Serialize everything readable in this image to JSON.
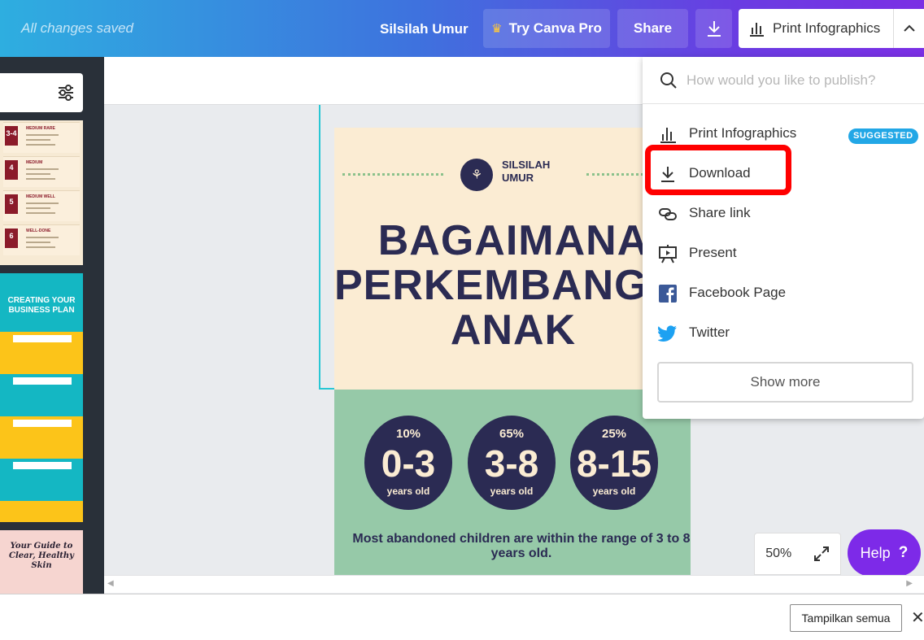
{
  "topbar": {
    "save_status": "All changes saved",
    "doc_title": "Silsilah Umur",
    "try_pro_label": "Try Canva Pro",
    "share_label": "Share",
    "print_label": "Print Infographics"
  },
  "sidebar": {
    "thumb1_rows": [
      {
        "num": "3-4",
        "head": "MEDIUM RARE"
      },
      {
        "num": "4",
        "head": "MEDIUM"
      },
      {
        "num": "5",
        "head": "MEDIUM WELL"
      },
      {
        "num": "6",
        "head": "WELL-DONE"
      }
    ],
    "thumb2_title": "CREATING YOUR BUSINESS PLAN",
    "thumb3_title": "Your Guide to Clear, Healthy Skin"
  },
  "design": {
    "logo_text": "SILSILAH\nUMUR",
    "headline": "BAGAIMANA\nPERKEMBANGAN\nANAK",
    "stats": [
      {
        "pct": "10%",
        "range": "0-3",
        "unit": "years old"
      },
      {
        "pct": "65%",
        "range": "3-8",
        "unit": "years old"
      },
      {
        "pct": "25%",
        "range": "8-15",
        "unit": "years old"
      }
    ],
    "caption": "Most abandoned children are within the range of 3 to 8 years old."
  },
  "zoom": {
    "level": "50%"
  },
  "help": {
    "label": "Help",
    "mark": "?"
  },
  "publish_menu": {
    "search_placeholder": "How would you like to publish?",
    "items": [
      {
        "label": "Print Infographics",
        "badge": "SUGGESTED"
      },
      {
        "label": "Download"
      },
      {
        "label": "Share link"
      },
      {
        "label": "Present"
      },
      {
        "label": "Facebook Page"
      },
      {
        "label": "Twitter"
      }
    ],
    "show_more_label": "Show more"
  },
  "downloads_bar": {
    "show_all_label": "Tampilkan semua"
  },
  "colors": {
    "accent_purple": "#7d2ae8",
    "suggested_badge": "#22a7e6",
    "highlight_red": "#ff0000",
    "design_navy": "#2b2b53",
    "design_cream": "#fbecd3",
    "design_green": "#96c9a8"
  }
}
